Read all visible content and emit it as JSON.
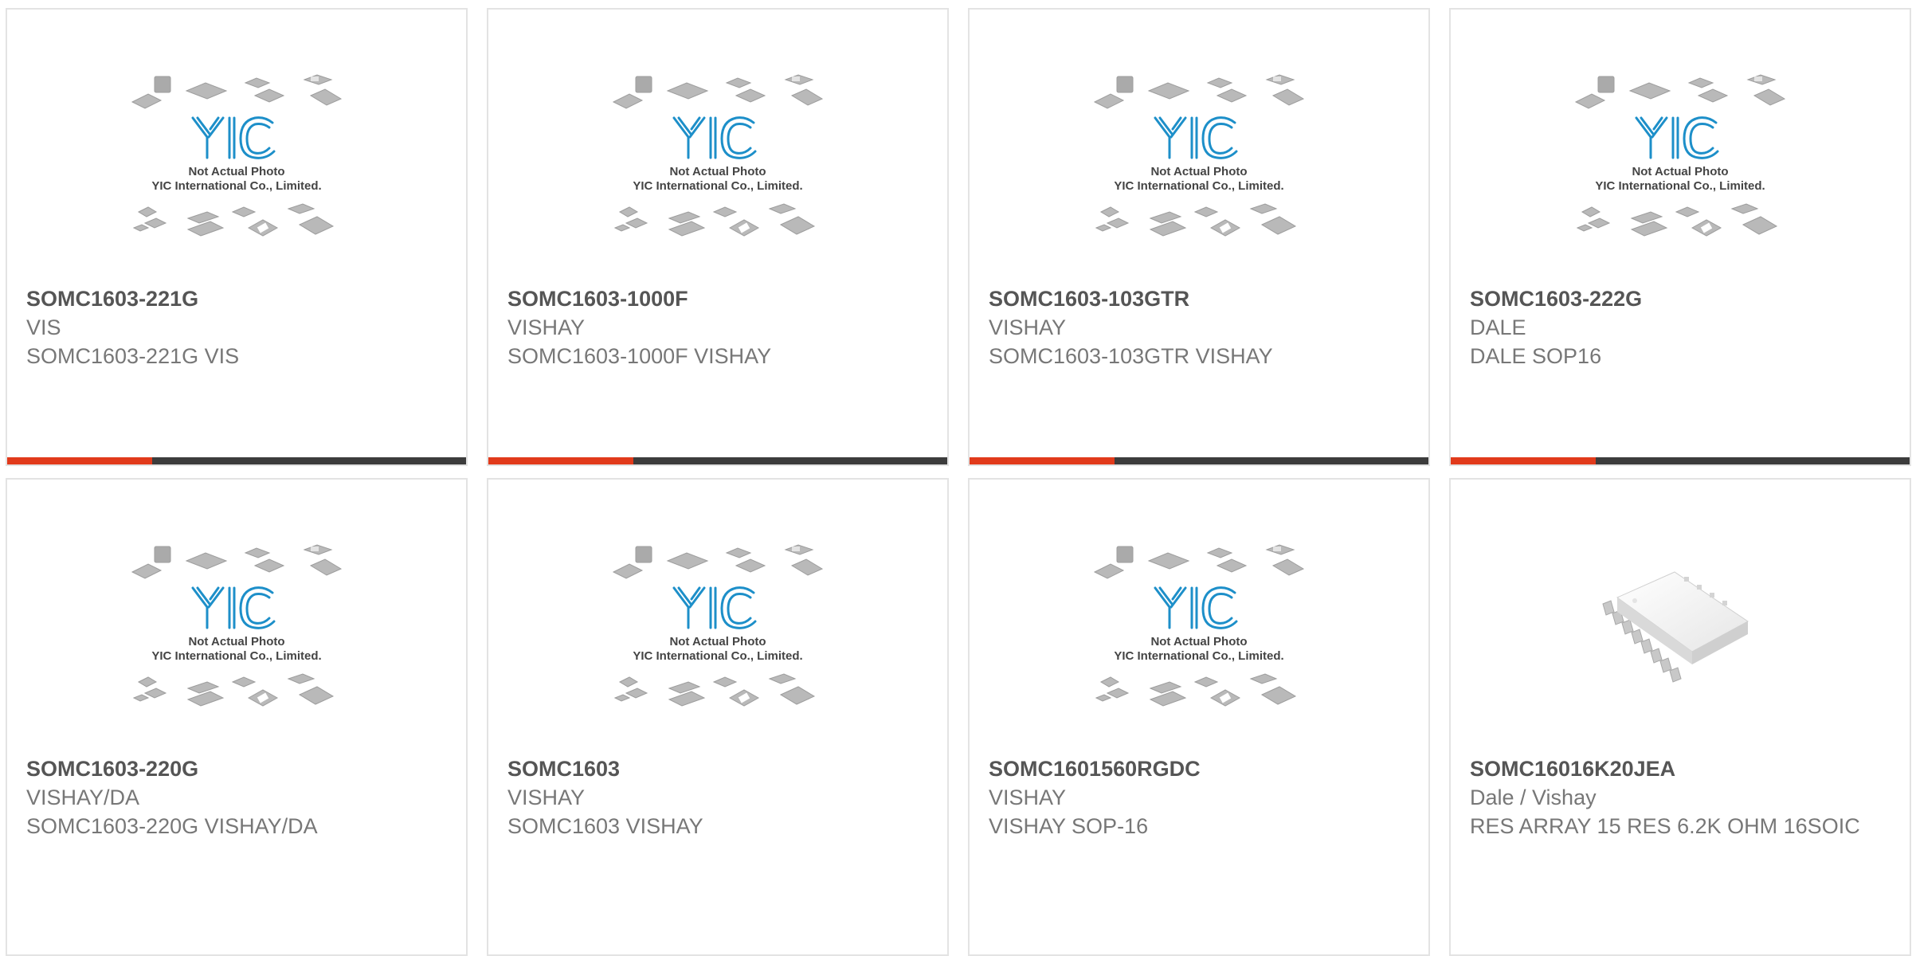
{
  "colors": {
    "accent_bar": "#e13a1b",
    "dark_bar": "#3c3c3c",
    "logo_blue": "#1d8fc9",
    "card_border": "#e3e3e3"
  },
  "placeholder": {
    "line1": "Not Actual Photo",
    "line2": "YIC International Co., Limited.",
    "logo": "YIC"
  },
  "products": [
    {
      "part": "SOMC1603-221G",
      "manufacturer": "VIS",
      "description": "SOMC1603-221G VIS",
      "image": "placeholder",
      "highlight_bar": true
    },
    {
      "part": "SOMC1603-1000F",
      "manufacturer": "VISHAY",
      "description": "SOMC1603-1000F VISHAY",
      "image": "placeholder",
      "highlight_bar": true
    },
    {
      "part": "SOMC1603-103GTR",
      "manufacturer": "VISHAY",
      "description": "SOMC1603-103GTR VISHAY",
      "image": "placeholder",
      "highlight_bar": true
    },
    {
      "part": "SOMC1603-222G",
      "manufacturer": "DALE",
      "description": "DALE SOP16",
      "image": "placeholder",
      "highlight_bar": true
    },
    {
      "part": "SOMC1603-220G",
      "manufacturer": "VISHAY/DA",
      "description": "SOMC1603-220G VISHAY/DA",
      "image": "placeholder",
      "highlight_bar": false
    },
    {
      "part": "SOMC1603",
      "manufacturer": "VISHAY",
      "description": "SOMC1603 VISHAY",
      "image": "placeholder",
      "highlight_bar": false
    },
    {
      "part": "SOMC1601560RGDC",
      "manufacturer": "VISHAY",
      "description": "VISHAY SOP-16",
      "image": "placeholder",
      "highlight_bar": false
    },
    {
      "part": "SOMC16016K20JEA",
      "manufacturer": "Dale / Vishay",
      "description": "RES ARRAY 15 RES 6.2K OHM 16SOIC",
      "image": "soic16-photo",
      "highlight_bar": false
    }
  ]
}
